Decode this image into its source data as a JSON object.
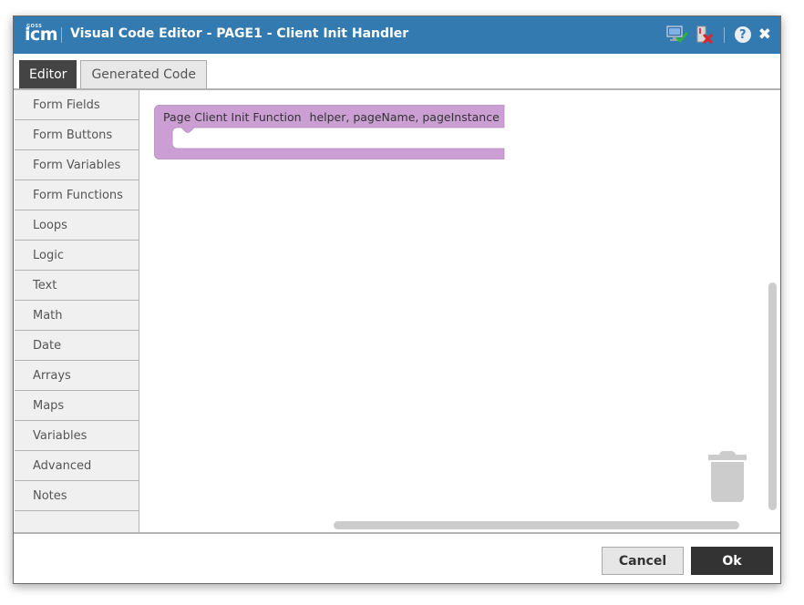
{
  "dialog": {
    "logo_small": "GOSS",
    "logo_main": "icm",
    "title": "Visual Code Editor - PAGE1 - Client Init Handler",
    "title_icons": [
      "monitor-check-icon",
      "server-error-icon",
      "help-icon",
      "close-icon"
    ],
    "help_glyph": "?",
    "close_glyph": "✖"
  },
  "tabs": [
    {
      "label": "Editor",
      "active": true
    },
    {
      "label": "Generated Code",
      "active": false
    }
  ],
  "toolbox": {
    "categories": [
      "Form Fields",
      "Form Buttons",
      "Form Variables",
      "Form Functions",
      "Loops",
      "Logic",
      "Text",
      "Math",
      "Date",
      "Arrays",
      "Maps",
      "Variables",
      "Advanced",
      "Notes"
    ]
  },
  "workspace": {
    "block": {
      "label": "Page Client Init Function",
      "params": "helper, pageName, pageInstance",
      "color": "#cc9fd4"
    }
  },
  "footer": {
    "cancel_label": "Cancel",
    "ok_label": "Ok"
  }
}
